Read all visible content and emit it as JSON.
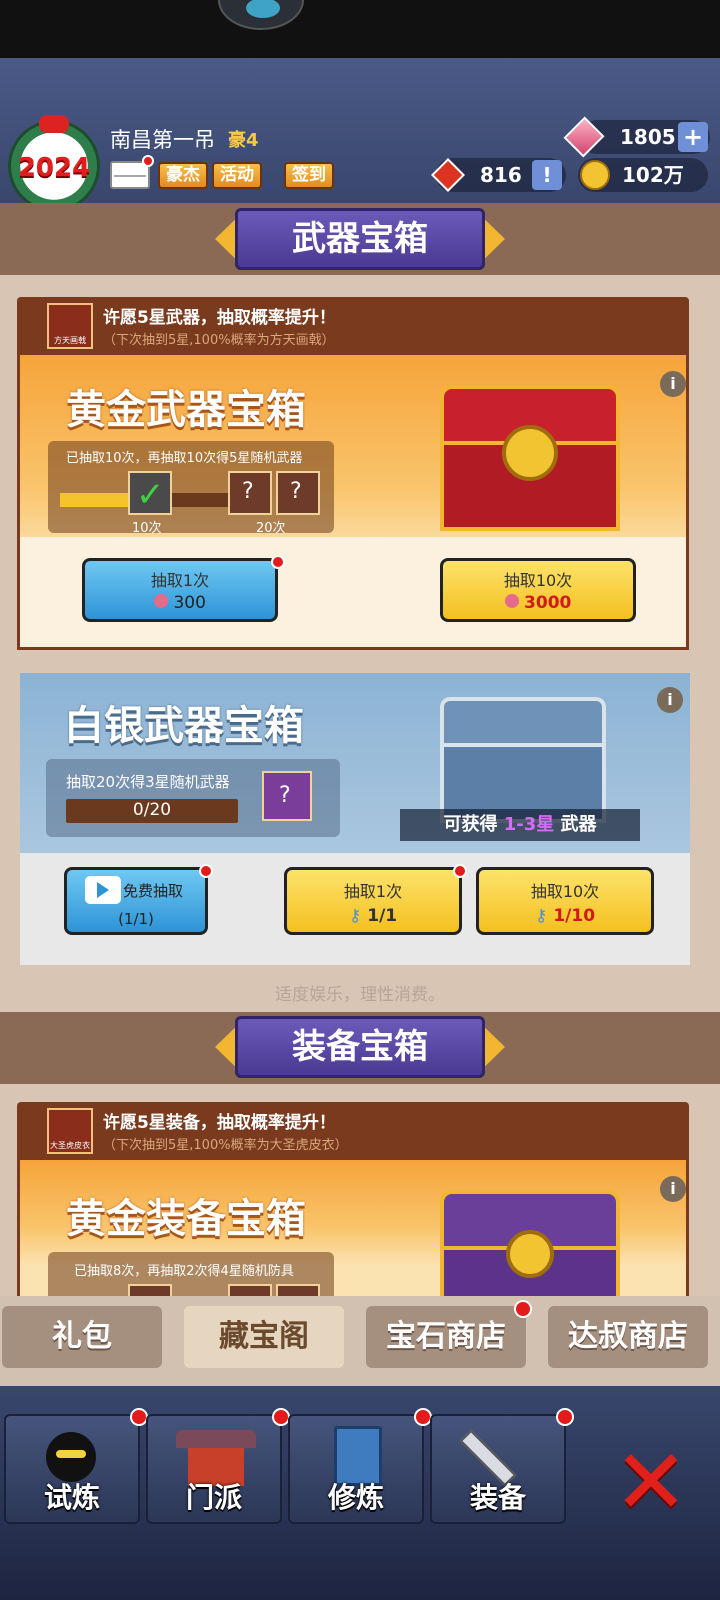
{
  "header": {
    "player_name": "南昌第一吊",
    "vip_level": "豪4",
    "year_badge": "2024",
    "buttons": [
      "豪杰",
      "活动",
      "签到"
    ],
    "gems": "1805",
    "tickets": "816",
    "gold": "102万"
  },
  "weapon_section": {
    "banner": "武器宝箱",
    "wish_title": "许愿5星武器，抽取概率提升！",
    "wish_sub": "（下次抽到5星,100%概率为方天画戟）",
    "wish_item": "方天画戟",
    "gold_chest": {
      "title": "黄金武器宝箱",
      "progress_text": "已抽取10次，再抽取10次得5星随机武器",
      "progress": 0.5,
      "milestone_1": "10次",
      "milestone_2": "20次",
      "draw1_label": "抽取1次",
      "draw1_cost": "300",
      "draw10_label": "抽取10次",
      "draw10_cost": "3000"
    },
    "silver_chest": {
      "title": "白银武器宝箱",
      "progress_text": "抽取20次得3星随机武器",
      "progress_count": "0/20",
      "obtain_prefix": "可获得",
      "obtain_range": "1-3星",
      "obtain_suffix": "武器",
      "free_label": "免费抽取",
      "free_count": "(1/1)",
      "draw1_label": "抽取1次",
      "draw1_cost": "1/1",
      "draw10_label": "抽取10次",
      "draw10_cost": "1/10"
    },
    "footer_note": "适度娱乐，理性消费。"
  },
  "equip_section": {
    "banner": "装备宝箱",
    "wish_title": "许愿5星装备，抽取概率提升！",
    "wish_sub": "（下次抽到5星,100%概率为大圣虎皮衣）",
    "wish_item": "大圣虎皮衣",
    "gold_chest": {
      "title": "黄金装备宝箱",
      "progress_text": "已抽取8次，再抽取2次得4星随机防具"
    }
  },
  "shop_tabs": [
    "礼包",
    "藏宝阁",
    "宝石商店",
    "达叔商店"
  ],
  "nav": [
    "试炼",
    "门派",
    "修炼",
    "装备"
  ],
  "colors": {
    "accent": "#4b3a93",
    "gold": "#f2b631",
    "red": "#e21b1b"
  }
}
